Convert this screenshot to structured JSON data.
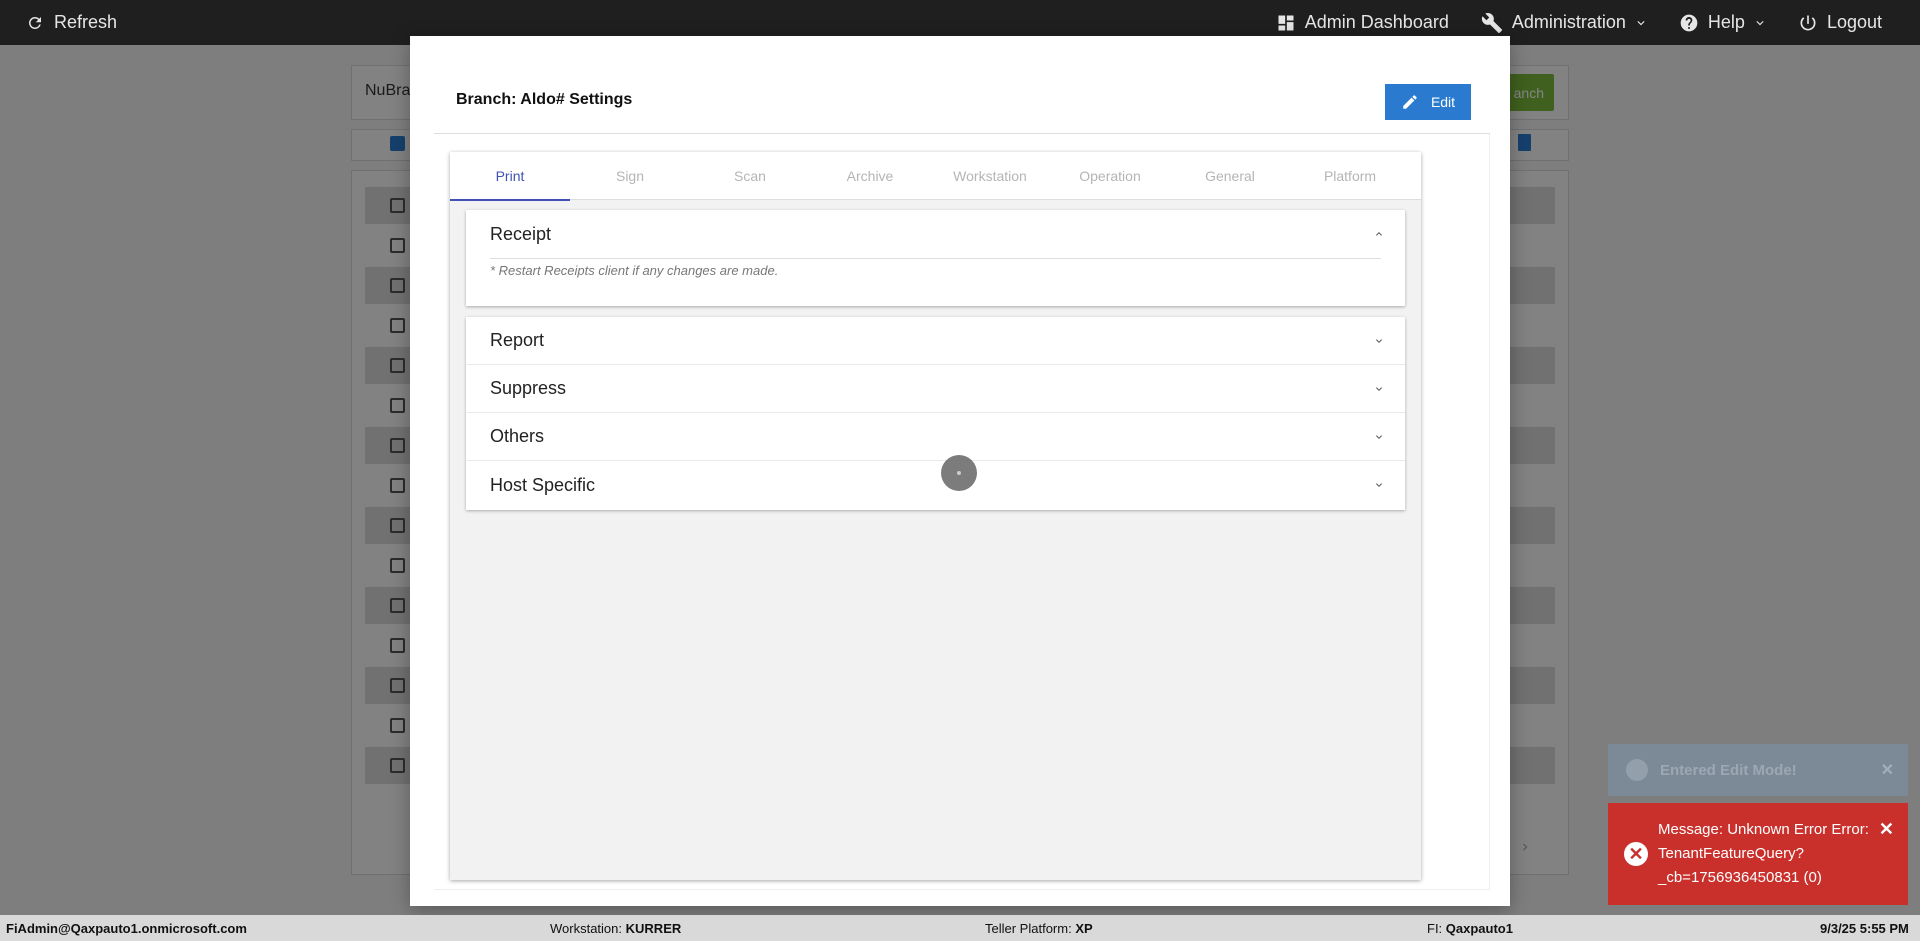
{
  "topbar": {
    "refresh_label": "Refresh",
    "admin_dashboard_label": "Admin Dashboard",
    "administration_label": "Administration",
    "help_label": "Help",
    "logout_label": "Logout"
  },
  "background": {
    "branch_field_value": "NuBra",
    "add_branch_label": "anch"
  },
  "modal": {
    "title": "Branch: Aldo# Settings",
    "edit_label": "Edit",
    "tabs": [
      "Print",
      "Sign",
      "Scan",
      "Archive",
      "Workstation",
      "Operation",
      "General",
      "Platform"
    ],
    "active_tab": "Print",
    "receipt": {
      "title": "Receipt",
      "note": "* Restart Receipts client if any changes are made."
    },
    "sections": [
      "Report",
      "Suppress",
      "Others",
      "Host Specific"
    ]
  },
  "toasts": {
    "info_text": "Entered Edit Mode!",
    "error_text": "Message: Unknown Error Error: TenantFeatureQuery?_cb=1756936450831 (0)"
  },
  "footer": {
    "user": "FiAdmin@Qaxpauto1.onmicrosoft.com",
    "workstation_label": "Workstation:",
    "workstation_value": "KURRER",
    "teller_label": "Teller Platform:",
    "teller_value": "XP",
    "fi_label": "FI:",
    "fi_value": "Qaxpauto1",
    "datetime": "9/3/25 5:55 PM"
  },
  "colors": {
    "primary": "#2a7bd0",
    "tab_active": "#3f51b5",
    "error": "#c9302c",
    "success": "#7ab83a"
  }
}
